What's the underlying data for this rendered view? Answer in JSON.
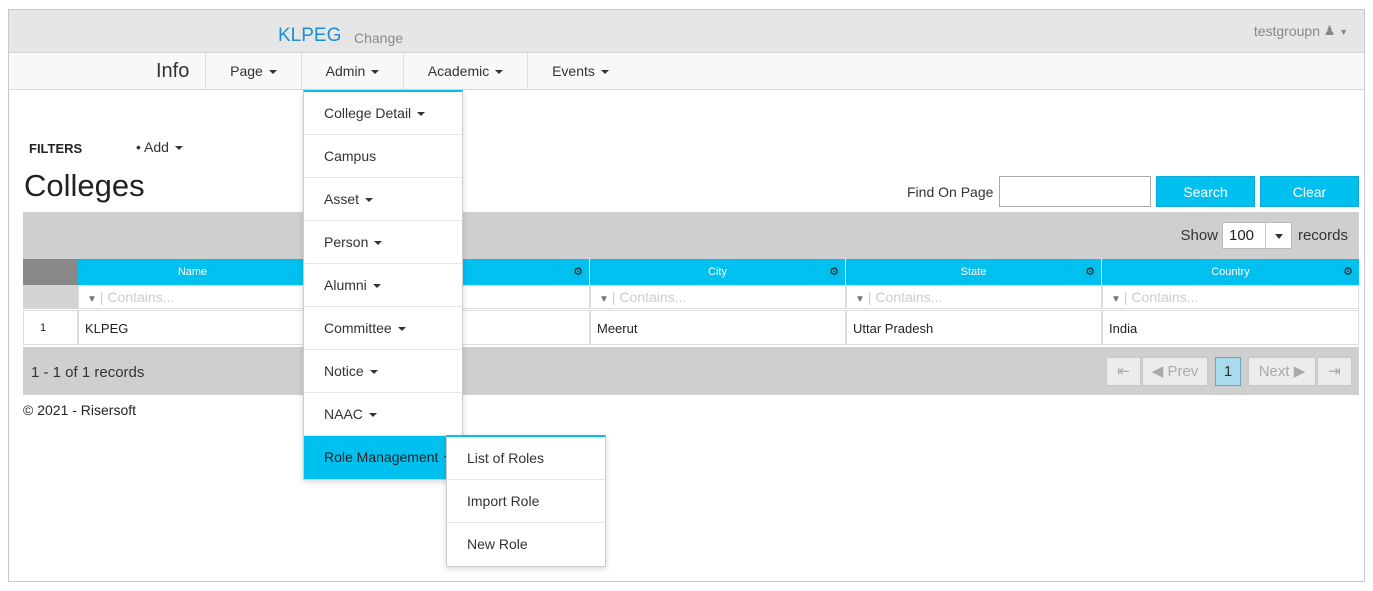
{
  "topbar": {
    "brand": "KLPEG",
    "change_label": "Change",
    "username": "testgroupn",
    "user_icon": "user-icon"
  },
  "nav": {
    "info": "Info",
    "items": [
      "Page",
      "Admin",
      "Academic",
      "Events"
    ]
  },
  "admin_menu": {
    "items": [
      "College Detail",
      "Campus",
      "Asset",
      "Person",
      "Alumni",
      "Committee",
      "Notice",
      "NAAC",
      "Role Management"
    ],
    "active": "Role Management"
  },
  "role_submenu": {
    "items": [
      "List of Roles",
      "Import Role",
      "New Role"
    ]
  },
  "content": {
    "filters_label": "FILTERS",
    "add_label": "Add",
    "title": "Colleges",
    "find_label": "Find On Page",
    "find_value": "",
    "search_button": "Search",
    "clear_button": "Clear"
  },
  "toolbar": {
    "show_label": "Show",
    "page_size": "100",
    "records_label": "records"
  },
  "grid": {
    "columns": [
      "Name",
      "s",
      "City",
      "State",
      "Country"
    ],
    "filter_placeholder": "Contains...",
    "rows": [
      {
        "num": "1",
        "name": "KLPEG",
        "city": "Meerut",
        "state": "Uttar Pradesh",
        "country": "India"
      }
    ]
  },
  "pager": {
    "summary": "1 - 1 of 1 records",
    "first": "⇤",
    "prev": "Prev",
    "current": "1",
    "next": "Next",
    "last": "⇥"
  },
  "footer": {
    "copyright": "© 2021 - Risersoft"
  },
  "colors": {
    "accent": "#00c0f0",
    "brand": "#1a8fd8",
    "toolbar_bg": "#cfcfcf"
  }
}
